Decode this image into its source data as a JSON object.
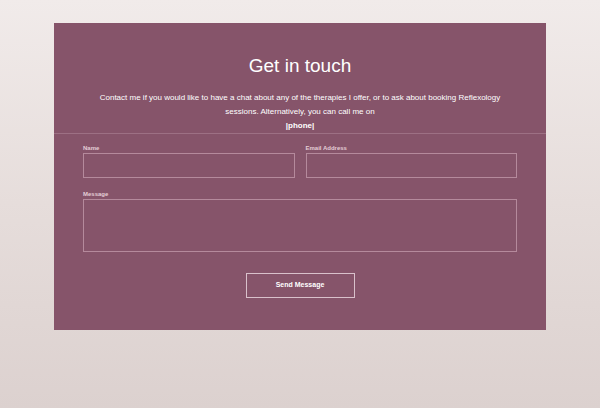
{
  "contact": {
    "title": "Get in touch",
    "intro": "Contact me if you would like to have a chat about any of the therapies I offer, or to ask about booking Reflexology sessions. Alternatively, you can call me on",
    "phone": "|phone|"
  },
  "form": {
    "fields": [
      {
        "label": "Name",
        "kind": "input"
      },
      {
        "label": "Email Address",
        "kind": "input"
      },
      {
        "label": "Message",
        "kind": "textarea"
      }
    ],
    "button": "Send Message"
  }
}
